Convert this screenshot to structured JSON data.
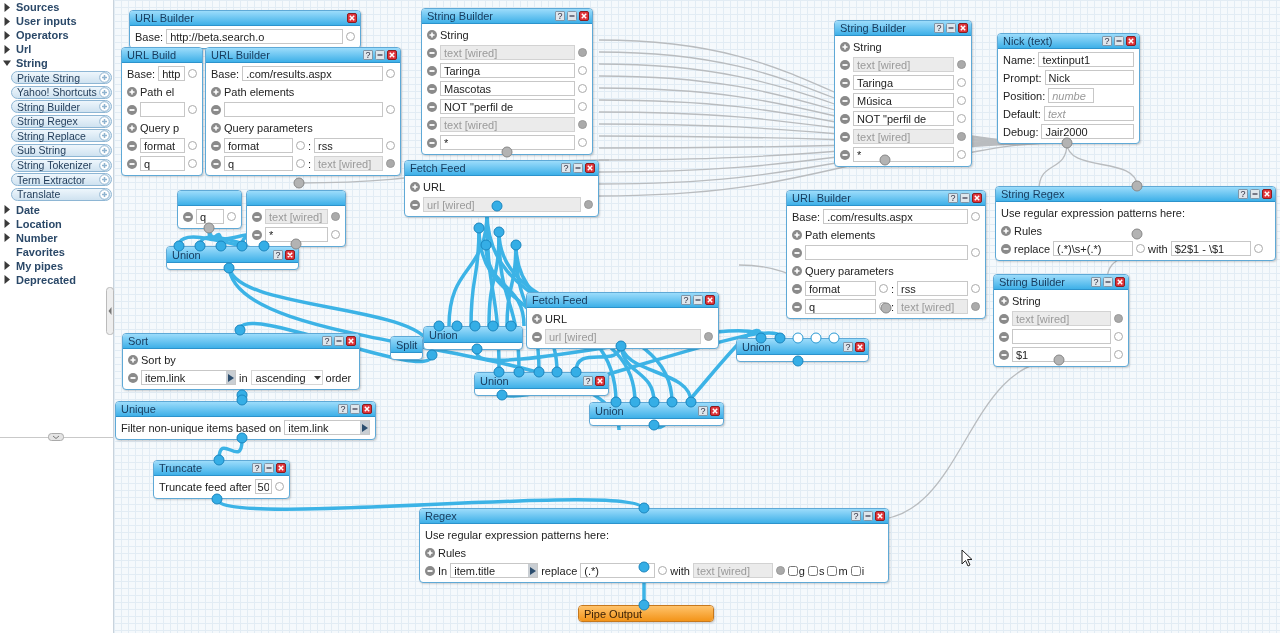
{
  "sidebar": {
    "items": [
      {
        "label": "Sources",
        "expanded": false
      },
      {
        "label": "User inputs",
        "expanded": false
      },
      {
        "label": "Operators",
        "expanded": false
      },
      {
        "label": "Url",
        "expanded": false
      },
      {
        "label": "String",
        "expanded": true,
        "children": [
          {
            "label": "Private String"
          },
          {
            "label": "Yahoo! Shortcuts"
          },
          {
            "label": "String Builder"
          },
          {
            "label": "String Regex"
          },
          {
            "label": "String Replace"
          },
          {
            "label": "Sub String"
          },
          {
            "label": "String Tokenizer"
          },
          {
            "label": "Term Extractor"
          },
          {
            "label": "Translate"
          }
        ]
      },
      {
        "label": "Date",
        "expanded": false
      },
      {
        "label": "Location",
        "expanded": false
      },
      {
        "label": "Number",
        "expanded": false
      },
      {
        "label": "Favorites"
      },
      {
        "label": "My pipes",
        "expanded": false
      },
      {
        "label": "Deprecated",
        "expanded": false
      }
    ]
  },
  "modules": [
    {
      "kind": "module",
      "title": "URL Builder",
      "controls": [
        {
          "kind": "close"
        }
      ],
      "rows": [
        {
          "kind": "base",
          "label": "Base:",
          "value": "http://beta.search.o"
        }
      ]
    },
    {
      "kind": "module",
      "title": "URL Build",
      "rows": [
        {
          "kind": "base",
          "label": "Base:",
          "value": "http"
        },
        {
          "kind": "group",
          "label": "Path el"
        },
        {
          "kind": "field",
          "wired": false
        },
        {
          "kind": "group",
          "label": "Query p"
        },
        {
          "kind": "field",
          "value": "format",
          "wired": false
        },
        {
          "kind": "field",
          "value": "q",
          "wired": false
        }
      ]
    },
    {
      "kind": "module",
      "title": "URL Builder",
      "controls": [
        {
          "kind": "help",
          "label": "?"
        },
        {
          "kind": "minimize"
        },
        {
          "kind": "close"
        }
      ],
      "rows": [
        {
          "kind": "base",
          "label": "Base:",
          "value": ".com/results.aspx"
        },
        {
          "kind": "group",
          "label": "Path elements"
        },
        {
          "kind": "field",
          "wired": false
        },
        {
          "kind": "group",
          "label": "Query parameters"
        },
        {
          "kind": "pair",
          "key": "format",
          "sep": ":",
          "value": "rss",
          "wired": false
        },
        {
          "kind": "pair",
          "key": "q",
          "sep": ":",
          "value": "text [wired]",
          "wired": true
        }
      ]
    },
    {
      "kind": "frame",
      "rows": [
        {
          "kind": "field",
          "value": "q",
          "wired": false
        }
      ]
    },
    {
      "kind": "frame",
      "rows": [
        {
          "kind": "field",
          "value": "text [wired]",
          "wired": true
        },
        {
          "kind": "field",
          "value": "*",
          "wired": false
        }
      ]
    },
    {
      "kind": "module",
      "title": "String Builder",
      "controls": [
        {
          "kind": "help",
          "label": "?"
        },
        {
          "kind": "minimize"
        },
        {
          "kind": "close"
        }
      ],
      "rows": [
        {
          "kind": "group",
          "label": "String"
        },
        {
          "kind": "field",
          "value": "text [wired]",
          "wired": true
        },
        {
          "kind": "field",
          "value": "Taringa",
          "wired": false
        },
        {
          "kind": "field",
          "value": "Mascotas",
          "wired": false
        },
        {
          "kind": "field",
          "value": "NOT \"perfil de",
          "wired": false
        },
        {
          "kind": "field",
          "value": "text [wired]",
          "wired": true
        },
        {
          "kind": "field",
          "value": "*",
          "wired": false
        }
      ]
    },
    {
      "kind": "module",
      "title": "Fetch Feed",
      "controls": [
        {
          "kind": "help",
          "label": "?"
        },
        {
          "kind": "minimize"
        },
        {
          "kind": "close"
        }
      ],
      "rows": [
        {
          "kind": "group",
          "label": "URL"
        },
        {
          "kind": "field",
          "value": "url [wired]",
          "wired": true
        }
      ]
    },
    {
      "kind": "union",
      "title": "Union",
      "controls": [
        {
          "kind": "help",
          "label": "?"
        },
        {
          "kind": "close"
        }
      ]
    },
    {
      "kind": "union",
      "title": "Split"
    },
    {
      "kind": "union",
      "title": "Union"
    },
    {
      "kind": "module",
      "title": "Fetch Feed",
      "controls": [
        {
          "kind": "help",
          "label": "?"
        },
        {
          "kind": "minimize"
        },
        {
          "kind": "close"
        }
      ],
      "rows": [
        {
          "kind": "group",
          "label": "URL"
        },
        {
          "kind": "field",
          "value": "url [wired]",
          "wired": true
        }
      ]
    },
    {
      "kind": "union",
      "title": "Union",
      "controls": [
        {
          "kind": "help",
          "label": "?"
        },
        {
          "kind": "close"
        }
      ]
    },
    {
      "kind": "union",
      "title": "Union",
      "controls": [
        {
          "kind": "help",
          "label": "?"
        },
        {
          "kind": "close"
        }
      ]
    },
    {
      "kind": "union",
      "title": "Union",
      "controls": [
        {
          "kind": "help",
          "label": "?"
        },
        {
          "kind": "close"
        }
      ]
    },
    {
      "kind": "module",
      "title": "String Builder",
      "controls": [
        {
          "kind": "help",
          "label": "?"
        },
        {
          "kind": "minimize"
        },
        {
          "kind": "close"
        }
      ],
      "rows": [
        {
          "kind": "group",
          "label": "String"
        },
        {
          "kind": "field",
          "value": "text [wired]",
          "wired": true
        },
        {
          "kind": "field",
          "value": "Taringa",
          "wired": false
        },
        {
          "kind": "field",
          "value": "Música",
          "wired": false
        },
        {
          "kind": "field",
          "value": "NOT \"perfil de",
          "wired": false
        },
        {
          "kind": "field",
          "value": "text [wired]",
          "wired": true
        },
        {
          "kind": "field",
          "value": "*",
          "wired": false
        }
      ]
    },
    {
      "kind": "module",
      "title": "Nick (text)",
      "controls": [
        {
          "kind": "help",
          "label": "?"
        },
        {
          "kind": "minimize"
        },
        {
          "kind": "close"
        }
      ],
      "rows": [
        {
          "kind": "labeled",
          "label": "Name:",
          "value": "textinput1"
        },
        {
          "kind": "labeled",
          "label": "Prompt:",
          "value": "Nick"
        },
        {
          "kind": "number",
          "label": "Position:",
          "placeholder": "numbe"
        },
        {
          "kind": "labeled",
          "label": "Default:",
          "placeholder": "text"
        },
        {
          "kind": "labeled",
          "label": "Debug:",
          "value": "Jair2000"
        }
      ]
    },
    {
      "kind": "module",
      "title": "URL Builder",
      "controls": [
        {
          "kind": "help",
          "label": "?"
        },
        {
          "kind": "minimize"
        },
        {
          "kind": "close"
        }
      ],
      "rows": [
        {
          "kind": "base",
          "label": "Base:",
          "value": ".com/results.aspx"
        },
        {
          "kind": "group",
          "label": "Path elements"
        },
        {
          "kind": "field",
          "wired": false
        },
        {
          "kind": "group",
          "label": "Query parameters"
        },
        {
          "kind": "pair",
          "key": "format",
          "sep": ":",
          "value": "rss",
          "wired": false
        },
        {
          "kind": "pair",
          "key": "q",
          "sep": ":",
          "value": "text [wired]",
          "wired": true
        }
      ]
    },
    {
      "kind": "module",
      "title": "String Regex",
      "controls": [
        {
          "kind": "help",
          "label": "?"
        },
        {
          "kind": "minimize"
        },
        {
          "kind": "close"
        }
      ],
      "rows": [
        {
          "kind": "text",
          "text": "Use regular expression patterns here:"
        },
        {
          "kind": "group",
          "label": "Rules"
        },
        {
          "kind": "replace",
          "word": "replace",
          "pattern": "(.*)\\s+(.*)",
          "with": "with",
          "value": "$2$1 - \\$1",
          "wired": false
        }
      ]
    },
    {
      "kind": "module",
      "title": "String Builder",
      "controls": [
        {
          "kind": "help",
          "label": "?"
        },
        {
          "kind": "minimize"
        },
        {
          "kind": "close"
        }
      ],
      "rows": [
        {
          "kind": "group",
          "label": "String"
        },
        {
          "kind": "field",
          "value": "text [wired]",
          "wired": true
        },
        {
          "kind": "field",
          "wired": false
        },
        {
          "kind": "field",
          "value": "$1",
          "wired": false
        }
      ]
    },
    {
      "kind": "module",
      "title": "Sort",
      "controls": [
        {
          "kind": "help",
          "label": "?"
        },
        {
          "kind": "minimize"
        },
        {
          "kind": "close"
        }
      ],
      "rows": [
        {
          "kind": "group",
          "label": "Sort by"
        },
        {
          "kind": "sort",
          "field": "item.link",
          "word": "in",
          "order": "ascending",
          "suffix": "order"
        }
      ]
    },
    {
      "kind": "module",
      "title": "Unique",
      "controls": [
        {
          "kind": "help",
          "label": "?"
        },
        {
          "kind": "minimize"
        },
        {
          "kind": "close"
        }
      ],
      "rows": [
        {
          "kind": "filter",
          "text": "Filter non-unique items based on",
          "field": "item.link"
        }
      ]
    },
    {
      "kind": "module",
      "title": "Truncate",
      "controls": [
        {
          "kind": "help",
          "label": "?"
        },
        {
          "kind": "minimize"
        },
        {
          "kind": "close"
        }
      ],
      "rows": [
        {
          "kind": "truncate",
          "text": "Truncate feed after",
          "value": "50"
        }
      ]
    },
    {
      "kind": "module",
      "title": "Regex",
      "controls": [
        {
          "kind": "help",
          "label": "?"
        },
        {
          "kind": "minimize"
        },
        {
          "kind": "close"
        }
      ],
      "rows": [
        {
          "kind": "text",
          "text": "Use regular expression patterns here:"
        },
        {
          "kind": "group",
          "label": "Rules"
        },
        {
          "kind": "regex",
          "word": "In",
          "field": "item.title",
          "replace": "replace",
          "pattern": "(.*)",
          "with": "with",
          "value": "text [wired]",
          "wired": true,
          "flags": [
            {
              "label": "g",
              "checked": false
            },
            {
              "label": "s",
              "checked": false
            },
            {
              "label": "m",
              "checked": false
            },
            {
              "label": "i",
              "checked": false
            }
          ]
        }
      ]
    },
    {
      "kind": "output",
      "title": "Pipe Output"
    }
  ]
}
